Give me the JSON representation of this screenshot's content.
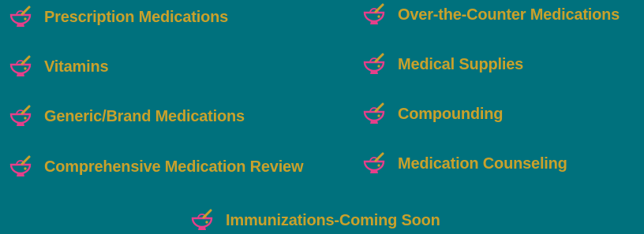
{
  "colors": {
    "background": "#00717d",
    "label": "#c9a12b",
    "icon_pink": "#e63f8a",
    "icon_gold": "#c9a12b"
  },
  "services": {
    "icon": "mortar-and-pestle-icon",
    "items": [
      {
        "label": "Prescription Medications"
      },
      {
        "label": "Over-the-Counter Medications"
      },
      {
        "label": "Vitamins"
      },
      {
        "label": "Medical Supplies"
      },
      {
        "label": "Generic/Brand Medications"
      },
      {
        "label": "Compounding"
      },
      {
        "label": "Comprehensive Medication Review"
      },
      {
        "label": "Medication Counseling"
      },
      {
        "label": "Immunizations-Coming Soon"
      }
    ]
  }
}
